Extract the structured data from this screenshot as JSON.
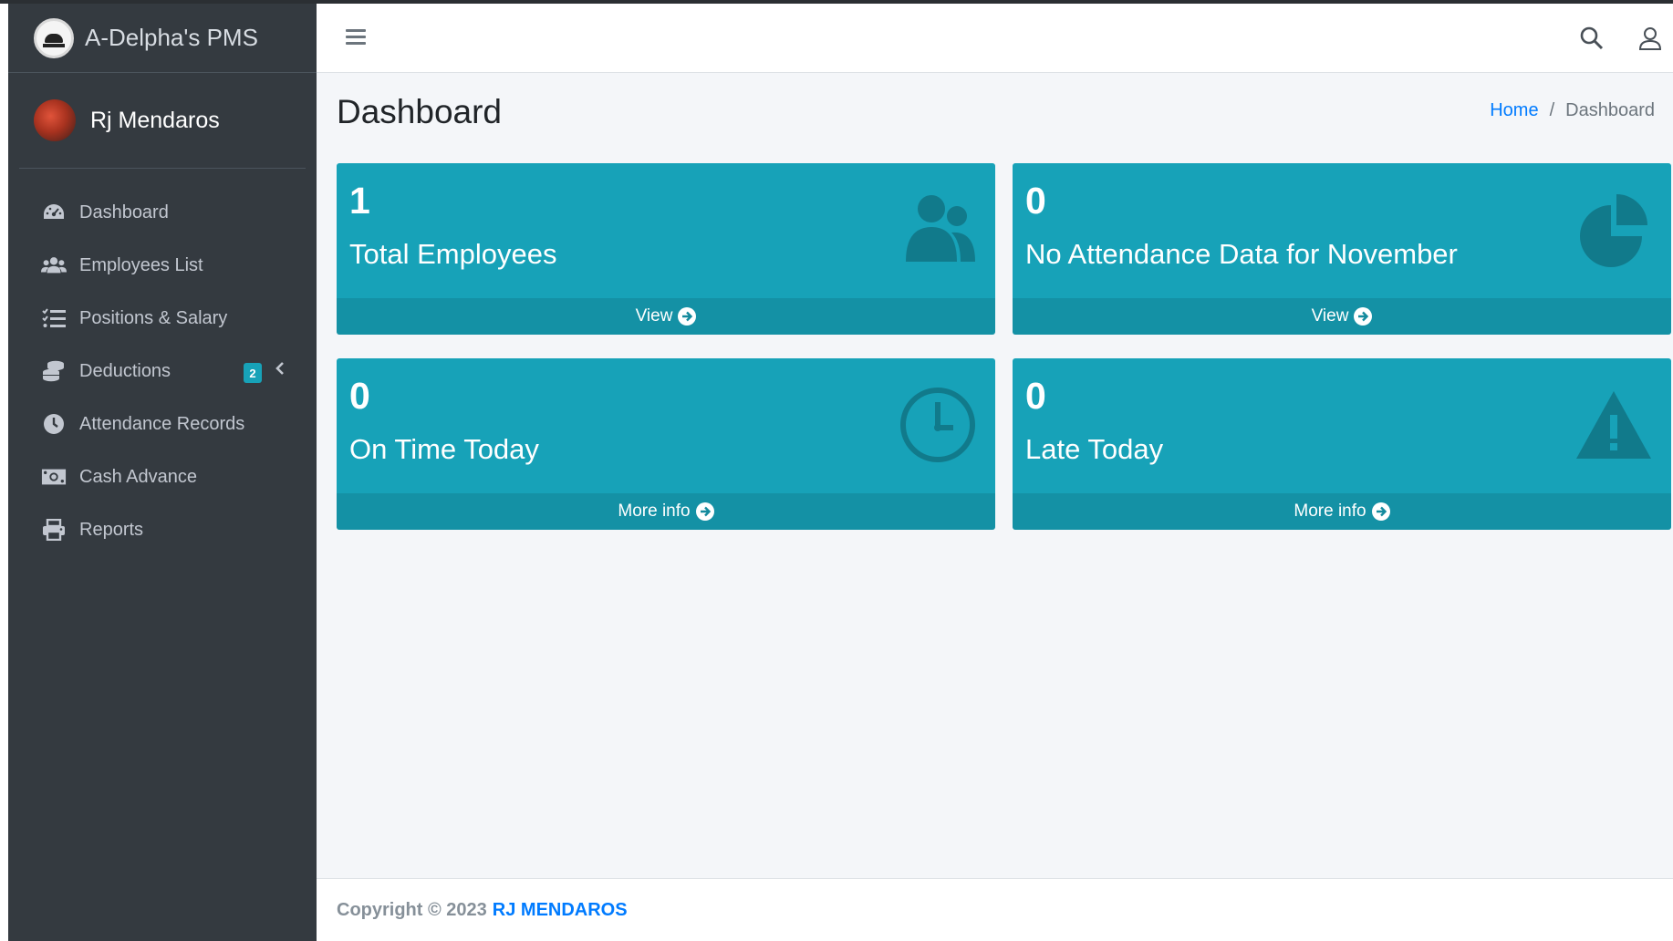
{
  "brand": {
    "title": "A-Delpha's PMS"
  },
  "user": {
    "name": "Rj Mendaros"
  },
  "sidebar": {
    "items": [
      {
        "label": "Dashboard",
        "icon": "dashboard-gauge-icon"
      },
      {
        "label": "Employees List",
        "icon": "users-icon"
      },
      {
        "label": "Positions & Salary",
        "icon": "list-icon"
      },
      {
        "label": "Deductions",
        "icon": "coins-icon",
        "badge": "2"
      },
      {
        "label": "Attendance Records",
        "icon": "clock-icon"
      },
      {
        "label": "Cash Advance",
        "icon": "money-bill-icon"
      },
      {
        "label": "Reports",
        "icon": "print-icon"
      }
    ]
  },
  "header": {
    "menu_icon": "hamburger-icon",
    "search_icon": "search-icon",
    "user_icon": "user-icon"
  },
  "page": {
    "title": "Dashboard",
    "breadcrumb": {
      "home": "Home",
      "separator": "/",
      "current": "Dashboard"
    }
  },
  "cards": [
    {
      "number": "1",
      "label": "Total Employees",
      "link": "View",
      "icon": "users-icon"
    },
    {
      "number": "0",
      "label": "No Attendance Data for November",
      "link": "View",
      "icon": "pie-chart-icon"
    },
    {
      "number": "0",
      "label": "On Time Today",
      "link": "More info",
      "icon": "clock-icon"
    },
    {
      "number": "0",
      "label": "Late Today",
      "link": "More info",
      "icon": "warning-icon"
    }
  ],
  "footer": {
    "text": "Copyright © 2023",
    "link": "RJ MENDAROS"
  },
  "colors": {
    "sidebar": "#343a40",
    "card": "#17a2b8",
    "link": "#007bff",
    "content_bg": "#f4f6f9"
  }
}
